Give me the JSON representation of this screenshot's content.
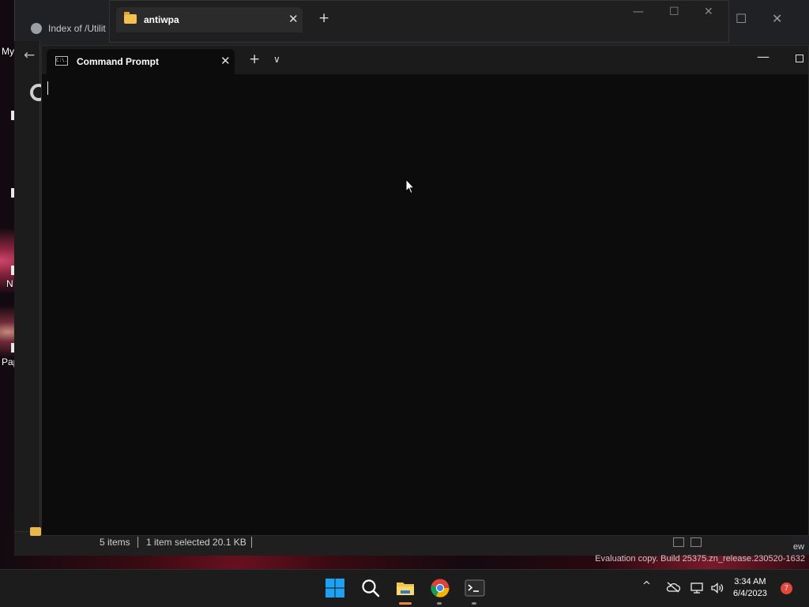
{
  "desktop": {
    "labels": [
      "My",
      "N",
      "Pap"
    ]
  },
  "browser": {
    "tab_title": "Index of /Utilit"
  },
  "explorer": {
    "tab_title": "antiwpa",
    "status": {
      "items": "5 items",
      "selected": "1 item selected  20.1 KB"
    },
    "view_stub": "ew"
  },
  "terminal": {
    "tab_title": "Command Prompt",
    "icon_text": "C:\\."
  },
  "watermark": "Evaluation copy. Build 25375.zn_release.230520-1632",
  "taskbar": {
    "apps": [
      {
        "name": "Start",
        "icon": "windows-logo-icon"
      },
      {
        "name": "Search",
        "icon": "search-icon"
      },
      {
        "name": "File Explorer",
        "icon": "folder-icon",
        "active": true
      },
      {
        "name": "Google Chrome",
        "icon": "chrome-icon",
        "running": true
      },
      {
        "name": "Terminal",
        "icon": "terminal-icon",
        "running": true
      }
    ],
    "tray": {
      "chevron": "^",
      "time": "3:34 AM",
      "date": "6/4/2023",
      "notification_count": "7"
    }
  },
  "colors": {
    "terminal_bg": "#0c0c0c",
    "titlebar_bg": "#1b1b1b",
    "taskbar_bg": "#1c1c1c",
    "accent_orange": "#e8893a",
    "windows_blue": "#1e90ff",
    "notification_red": "#e3473a"
  }
}
